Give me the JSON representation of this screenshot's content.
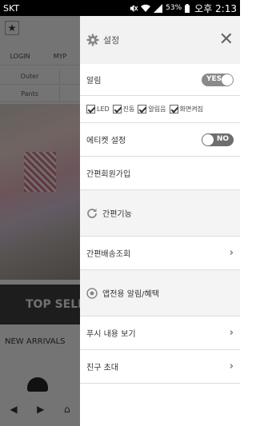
{
  "status_bar": {
    "carrier": "SKT",
    "battery": "53%",
    "time": "오후 2:13"
  },
  "background_app": {
    "top_links": [
      "LOGIN",
      "MYP"
    ],
    "categories": [
      "Outer",
      "Pants"
    ],
    "banner": "TOP SELL",
    "section": "NEW ARRIVALS"
  },
  "drawer": {
    "header": {
      "title": "설정",
      "close": "✕"
    },
    "notification": {
      "label": "알림",
      "toggle": "YES"
    },
    "options": [
      "LED",
      "진동",
      "알림음",
      "화면켜짐"
    ],
    "etiquette": {
      "label": "에티켓 설정",
      "toggle": "NO"
    },
    "easy_signup": "간편회원가입",
    "easy_feature": "간편기능",
    "easy_shipping": "간편배송조회",
    "app_alert": "앱전용 알림/혜택",
    "push_view": "푸시 내용 보기",
    "invite": "친구 초대"
  }
}
